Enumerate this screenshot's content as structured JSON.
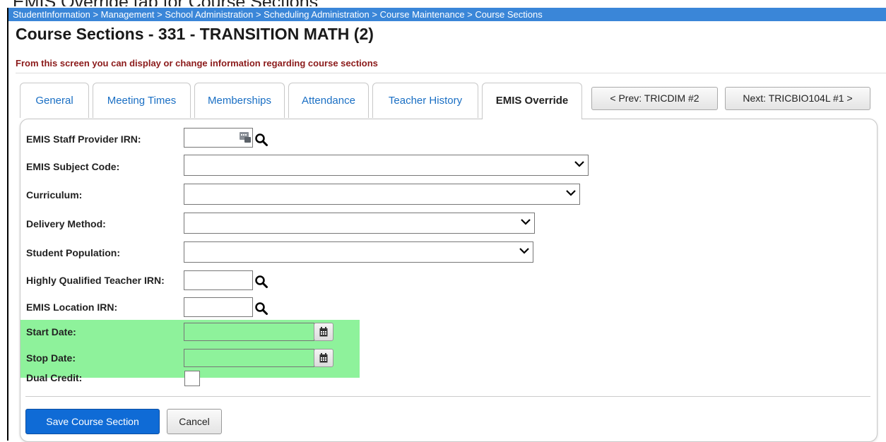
{
  "caption": "EMIS Override tab for Course Sections",
  "breadcrumb": "StudentInformation > Management > School Administration > Scheduling Administration > Course Maintenance > Course Sections",
  "page": {
    "title": "Course Sections - 331 - TRANSITION MATH (2)",
    "subtitle": "From this screen you can display or change information regarding course sections"
  },
  "tabs": [
    {
      "label": "General",
      "active": false
    },
    {
      "label": "Meeting Times",
      "active": false
    },
    {
      "label": "Memberships",
      "active": false
    },
    {
      "label": "Attendance",
      "active": false
    },
    {
      "label": "Teacher History",
      "active": false
    },
    {
      "label": "EMIS Override",
      "active": true
    }
  ],
  "nav": {
    "prev_label": "< Prev: TRICDIM #2",
    "next_label": "Next: TRICBIO104L #1 >"
  },
  "form": {
    "staff_provider_irn": {
      "label": "EMIS Staff Provider IRN:",
      "value": ""
    },
    "subject_code": {
      "label": "EMIS Subject Code:",
      "value": ""
    },
    "curriculum": {
      "label": "Curriculum:",
      "value": ""
    },
    "delivery_method": {
      "label": "Delivery Method:",
      "value": ""
    },
    "student_population": {
      "label": "Student Population:",
      "value": ""
    },
    "hq_teacher_irn": {
      "label": "Highly Qualified Teacher IRN:",
      "value": ""
    },
    "location_irn": {
      "label": "EMIS Location IRN:",
      "value": ""
    },
    "start_date": {
      "label": "Start Date:",
      "value": ""
    },
    "stop_date": {
      "label": "Stop Date:",
      "value": ""
    },
    "dual_credit": {
      "label": "Dual Credit:",
      "checked": false
    }
  },
  "actions": {
    "save_label": "Save Course Section",
    "cancel_label": "Cancel"
  },
  "colors": {
    "breadcrumb_bg": "#3a86d8",
    "subtitle": "#8b1a1a",
    "tab_link": "#1a6fc4",
    "highlight": "#8ef29b",
    "primary_button": "#0f6bd6"
  },
  "icons": {
    "search": "search-icon",
    "calendar": "calendar-icon",
    "staff_lookup": "staff-lookup-icon",
    "dropdown": "chevron-down-icon"
  }
}
